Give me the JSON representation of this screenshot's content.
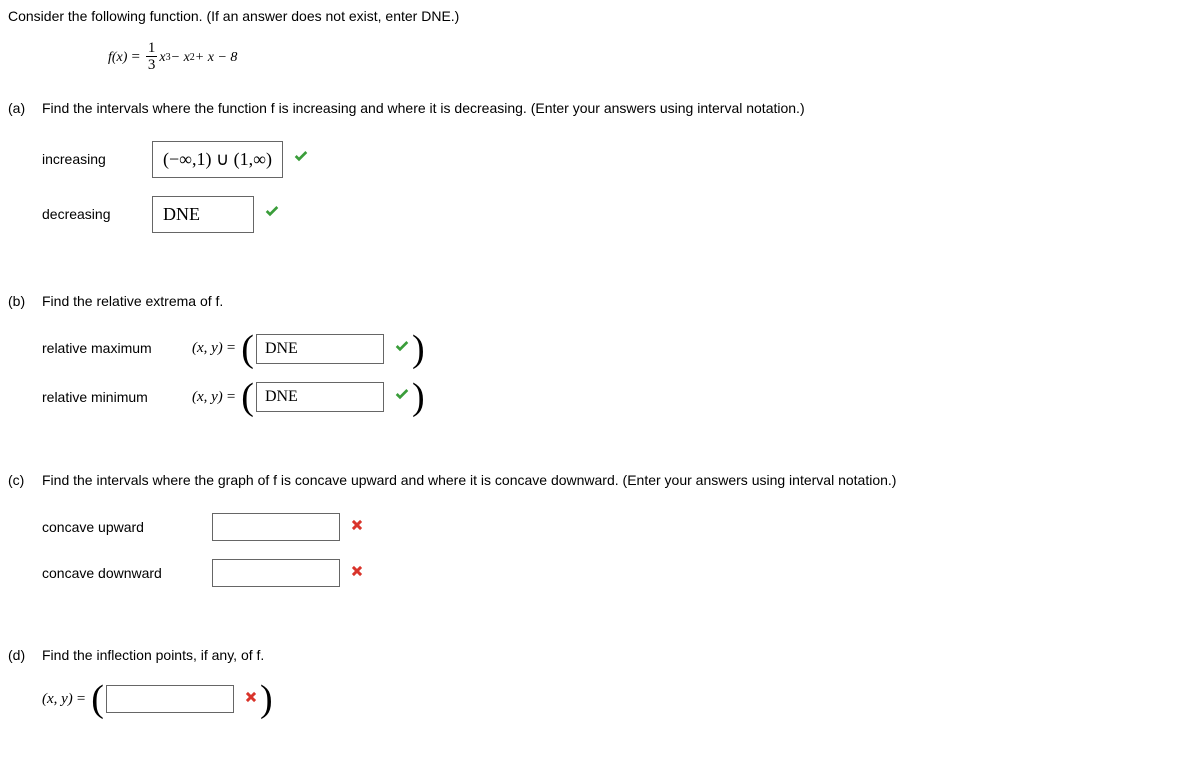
{
  "prompt": "Consider the following function. (If an answer does not exist, enter DNE.)",
  "equation": {
    "lhs": "f(x)",
    "frac_num": "1",
    "frac_den": "3",
    "rhs_after_frac": "x",
    "exp1": "3",
    "minus": " − x",
    "exp2": "2",
    "tail": " + x − 8"
  },
  "parts": {
    "a": {
      "label": "(a)",
      "text": "Find the intervals where the function f is increasing and where it is decreasing. (Enter your answers using interval notation.)",
      "increasing_label": "increasing",
      "increasing_value": "(−∞,1) ∪ (1,∞)",
      "decreasing_label": "decreasing",
      "decreasing_value": "DNE"
    },
    "b": {
      "label": "(b)",
      "text": "Find the relative extrema of f.",
      "max_label": "relative maximum",
      "min_label": "relative minimum",
      "xy": "(x, y)",
      "max_value": "DNE",
      "min_value": "DNE"
    },
    "c": {
      "label": "(c)",
      "text": "Find the intervals where the graph of f is concave upward and where it is concave downward. (Enter your answers using interval notation.)",
      "up_label": "concave upward",
      "down_label": "concave downward",
      "up_value": "",
      "down_value": ""
    },
    "d": {
      "label": "(d)",
      "text": "Find the inflection points, if any, of f.",
      "xy": "(x, y)",
      "value": ""
    }
  }
}
